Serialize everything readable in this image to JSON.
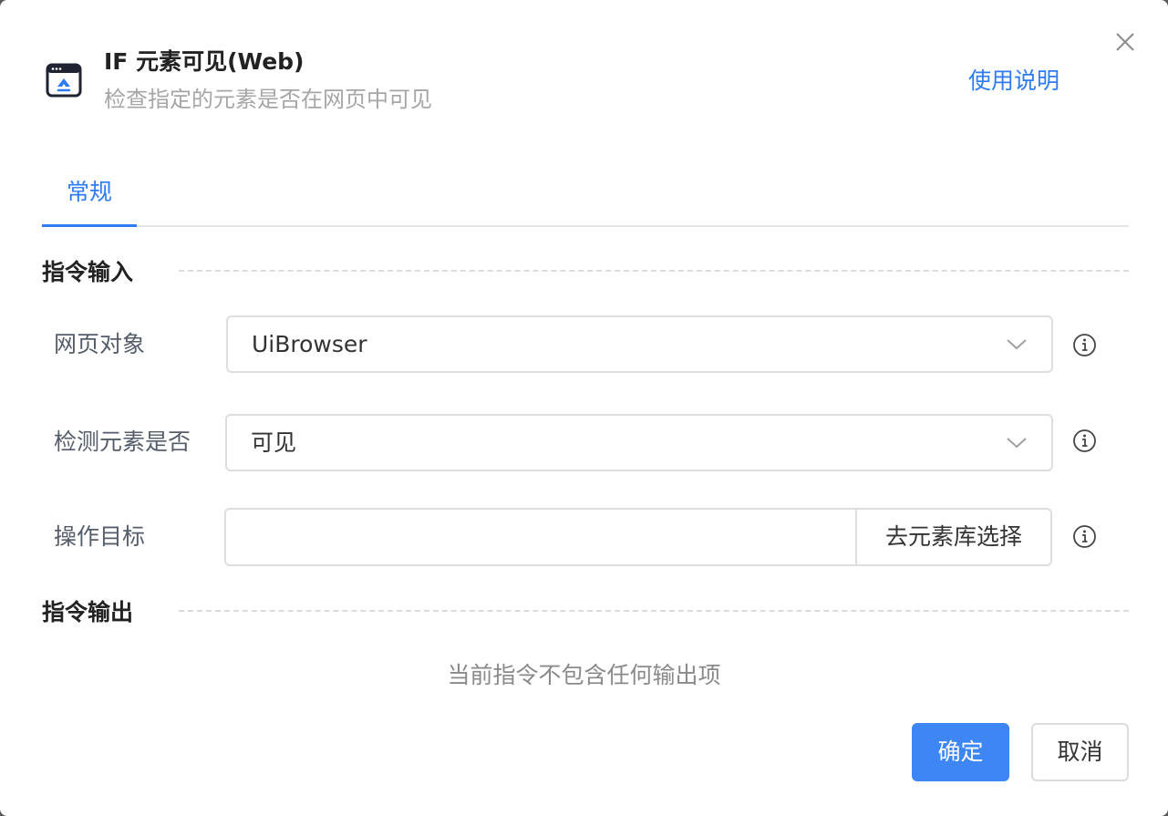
{
  "dialog": {
    "title": "IF 元素可见(Web)",
    "subtitle": "检查指定的元素是否在网页中可见",
    "help_link": "使用说明",
    "icon": "browser-window-icon",
    "close_icon": "close-icon"
  },
  "tabs": [
    {
      "label": "常规",
      "active": true
    }
  ],
  "input_section": {
    "title": "指令输入",
    "fields": [
      {
        "label": "网页对象",
        "type": "select",
        "value": "UiBrowser"
      },
      {
        "label": "检测元素是否",
        "type": "select",
        "value": "可见"
      },
      {
        "label": "操作目标",
        "type": "input",
        "value": "",
        "button_label": "去元素库选择"
      }
    ]
  },
  "output_section": {
    "title": "指令输出",
    "empty_text": "当前指令不包含任何输出项"
  },
  "footer": {
    "ok_label": "确定",
    "cancel_label": "取消"
  },
  "colors": {
    "accent": "#2f7bf5",
    "primary_button": "#3d86f4"
  }
}
